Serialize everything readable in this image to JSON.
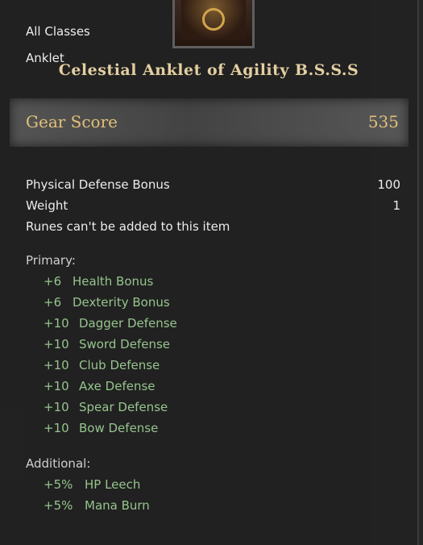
{
  "tooltip": {
    "class_restriction": "All Classes",
    "item_type": "Anklet",
    "item_name": "Celestial Anklet of Agility B.S.S.S",
    "gear_score": {
      "label": "Gear Score",
      "value": "535"
    },
    "properties": [
      {
        "label": "Physical Defense Bonus",
        "value": "100"
      },
      {
        "label": "Weight",
        "value": "1"
      }
    ],
    "rune_note": "Runes can't be added to this item",
    "primary": {
      "header": "Primary:",
      "stats": [
        {
          "amount": "+6",
          "name": "Health Bonus"
        },
        {
          "amount": "+6",
          "name": "Dexterity Bonus"
        },
        {
          "amount": "+10",
          "name": "Dagger Defense"
        },
        {
          "amount": "+10",
          "name": "Sword Defense"
        },
        {
          "amount": "+10",
          "name": "Club Defense"
        },
        {
          "amount": "+10",
          "name": "Axe Defense"
        },
        {
          "amount": "+10",
          "name": "Spear Defense"
        },
        {
          "amount": "+10",
          "name": "Bow Defense"
        }
      ]
    },
    "additional": {
      "header": "Additional:",
      "stats": [
        {
          "amount": "+5%",
          "name": "HP Leech"
        },
        {
          "amount": "+5%",
          "name": "Mana Burn"
        }
      ]
    },
    "icon": "anklet-icon"
  },
  "colors": {
    "title": "#e3cfa1",
    "gear_score": "#e3c07a",
    "stat_green": "#96c48e",
    "text": "#ececec"
  }
}
